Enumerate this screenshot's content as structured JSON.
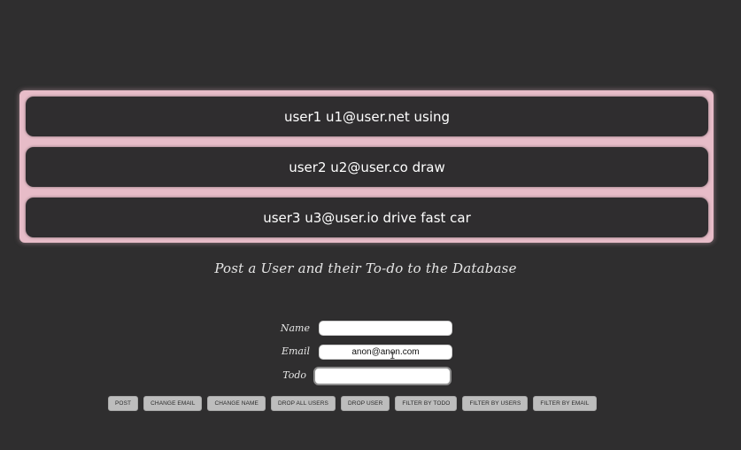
{
  "users": [
    {
      "text": "user1 u1@user.net using"
    },
    {
      "text": "user2 u2@user.co draw"
    },
    {
      "text": "user3 u3@user.io drive fast car"
    }
  ],
  "form": {
    "heading": "Post a User and their To-do to the Database",
    "name_label": "Name",
    "name_value": "",
    "email_label": "Email",
    "email_value": "anon@anon.com",
    "todo_label": "Todo",
    "todo_value": ""
  },
  "buttons": {
    "post": "POST",
    "change_email": "CHANGE EMAIL",
    "change_name": "CHANGE NAME",
    "drop_all_users": "DROP ALL USERS",
    "drop_user": "DROP USER",
    "filter_by_todo": "FILTER BY TODO",
    "filter_by_users": "FILTER BY USERS",
    "filter_by_email": "FILTER BY EMAIL"
  },
  "colors": {
    "background": "#2f2e2f",
    "list_panel": "#e7bcc8",
    "row_background": "#2f2d2f",
    "button": "#bdbdbd"
  },
  "icons": {
    "text_cursor": "i-beam-cursor-icon"
  }
}
